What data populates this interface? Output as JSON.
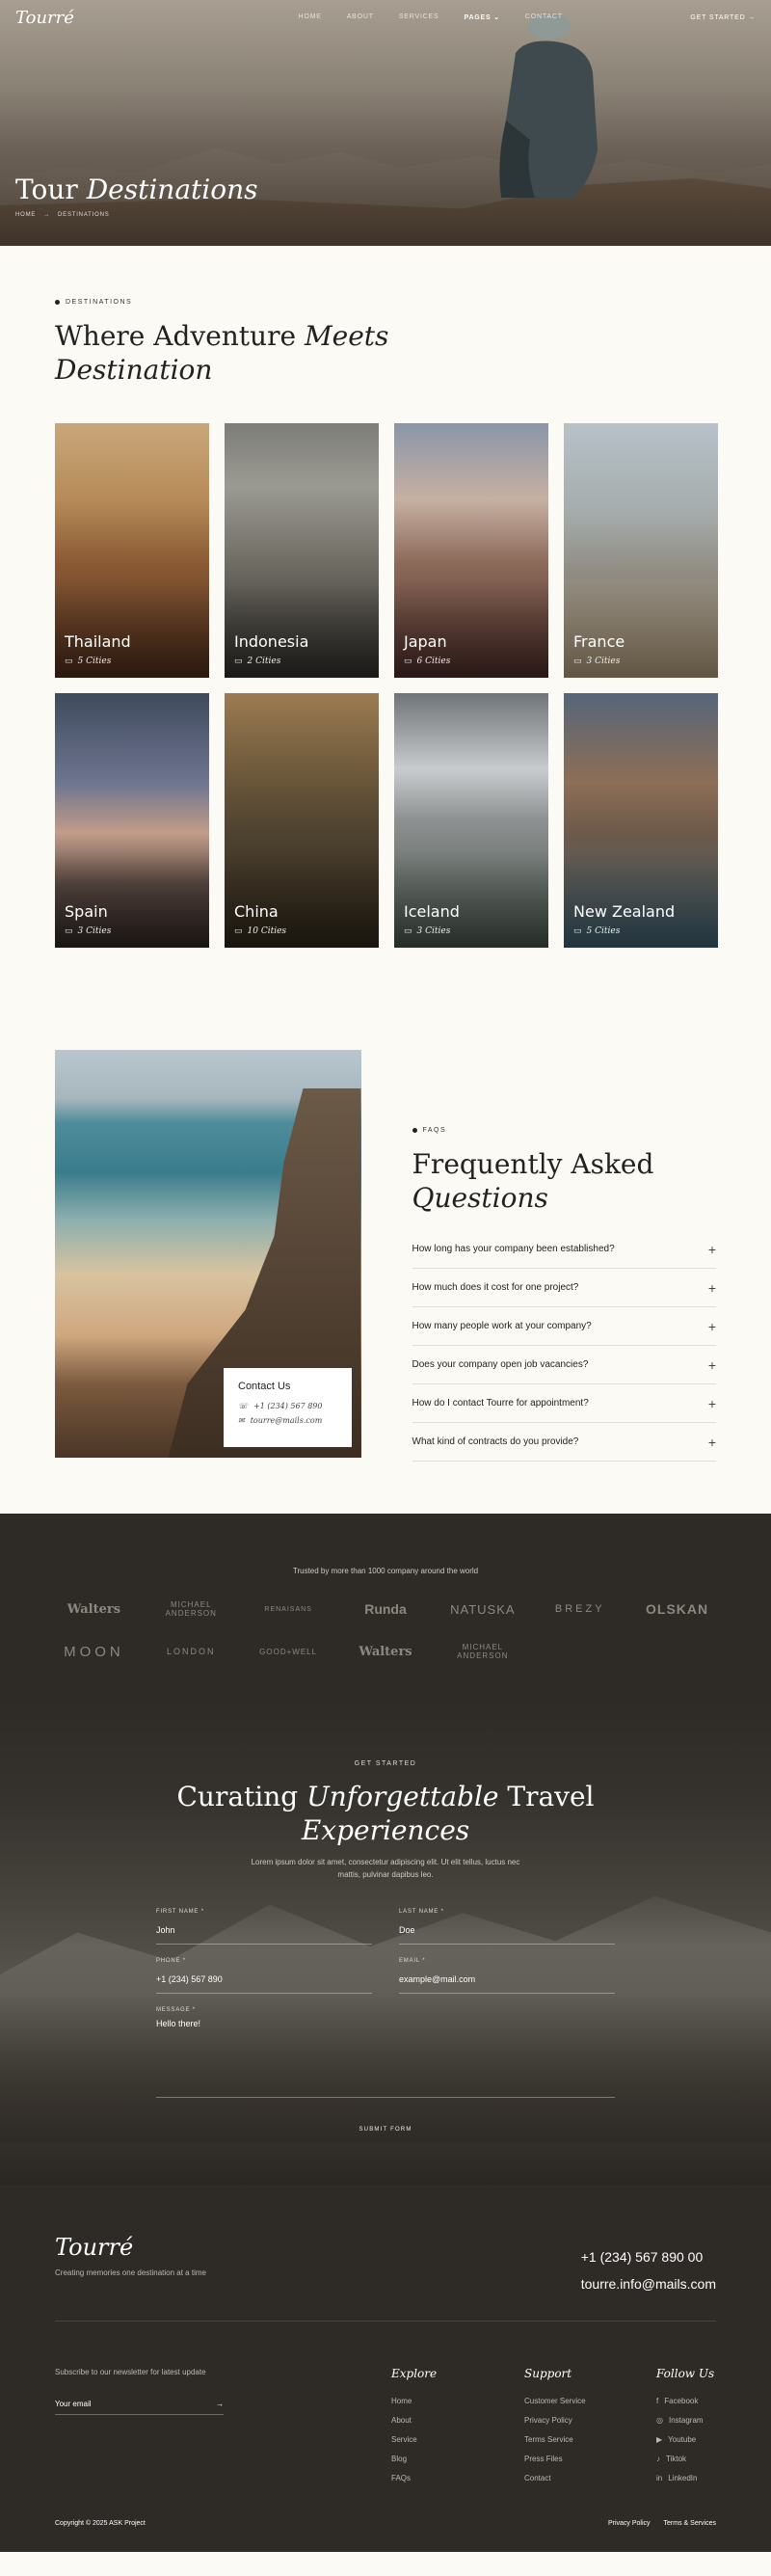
{
  "header": {
    "logo": "Tourré",
    "menu": [
      {
        "label": "HOME"
      },
      {
        "label": "ABOUT"
      },
      {
        "label": "SERVICES"
      },
      {
        "label": "PAGES ⌄"
      },
      {
        "label": "CONTACT"
      }
    ],
    "cta": "GET STARTED →"
  },
  "hero": {
    "title_plain": "Tour",
    "title_italic": "Destinations",
    "crumb_home": "HOME",
    "crumb_sep": "→",
    "crumb_current": "DESTINATIONS"
  },
  "destinations": {
    "eyebrow": "DESTINATIONS",
    "title_plain": "Where Adventure",
    "title_italic_1": "Meets",
    "title_italic_2": "Destination",
    "cards": [
      {
        "name": "Thailand",
        "cities": "5 Cities",
        "bg": "linear-gradient(180deg,#c9a77a 0%,#b68b58 30%,#8a5a34 55%,#4d2c1a 100%)"
      },
      {
        "name": "Indonesia",
        "cities": "2 Cities",
        "bg": "linear-gradient(180deg,#7d7d79 0%,#9b9a92 25%,#6f6c64 55%,#2f2d29 100%)"
      },
      {
        "name": "Japan",
        "cities": "6 Cities",
        "bg": "linear-gradient(180deg,#8a96a8 0%,#c6b0a2 30%,#8c6a5a 55%,#4b2c28 100%)"
      },
      {
        "name": "France",
        "cities": "3 Cities",
        "bg": "linear-gradient(180deg,#b7c1c8 0%,#a5acac 35%,#8f8a80 60%,#b09b7c 100%)"
      },
      {
        "name": "Spain",
        "cities": "3 Cities",
        "bg": "linear-gradient(180deg,#3f4a5c 0%,#6d7590 35%,#c29c88 55%,#5b4a45 75%,#2e2622 100%)"
      },
      {
        "name": "China",
        "cities": "10 Cities",
        "bg": "linear-gradient(180deg,#9c7c52 0%,#6f5a3c 30%,#4e4230 55%,#2d2518 100%)"
      },
      {
        "name": "Iceland",
        "cities": "3 Cities",
        "bg": "linear-gradient(180deg,#6f7478 0%,#c9ccce 30%,#8d9090 50%,#45524a 100%)"
      },
      {
        "name": "New Zealand",
        "cities": "5 Cities",
        "bg": "linear-gradient(180deg,#566679 0%,#8d6e57 35%,#6d5a4a 55%,#3e5e70 100%)"
      }
    ]
  },
  "faq": {
    "eyebrow": "FAQS",
    "title_plain": "Frequently Asked",
    "title_italic": "Questions",
    "questions": [
      {
        "q": "How long has your company been established?"
      },
      {
        "q": "How much does it cost for one project?"
      },
      {
        "q": "How many people work at your company?"
      },
      {
        "q": "Does your company open job vacancies?"
      },
      {
        "q": "How do I contact Tourre for appointment?"
      },
      {
        "q": "What kind of contracts do you provide?"
      }
    ],
    "contact": {
      "title": "Contact Us",
      "phone": "+1 (234) 567 890",
      "email": "tourre@mails.com"
    }
  },
  "trust": {
    "text": "Trusted by more than 1000 company around the world",
    "logos": [
      {
        "name": "Walters"
      },
      {
        "name": "MICHAEL ANDERSON"
      },
      {
        "name": "RENAISANS"
      },
      {
        "name": "Runda"
      },
      {
        "name": "NATUSKA"
      },
      {
        "name": "BREZY"
      },
      {
        "name": "OLSKAN"
      },
      {
        "name": "MOON"
      },
      {
        "name": "LONDON"
      },
      {
        "name": "GOOD+WELL"
      },
      {
        "name": "Walters"
      },
      {
        "name": "MICHAEL ANDERSON"
      }
    ]
  },
  "cta": {
    "eyebrow": "GET STARTED",
    "title_1_plain": "Curating",
    "title_1_italic": "Unforgettable",
    "title_1_plain2": "Travel",
    "title_2_italic": "Experiences",
    "desc": "Lorem ipsum dolor sit amet, consectetur adipiscing elit. Ut elit tellus, luctus nec mattis, pulvinar dapibus leo.",
    "first_name_label": "FIRST NAME *",
    "first_name_value": "John",
    "last_name_label": "LAST NAME *",
    "last_name_value": "Doe",
    "phone_label": "PHONE *",
    "phone_value": "+1 (234) 567 890",
    "email_label": "EMAIL *",
    "email_value": "example@mail.com",
    "message_label": "MESSAGE *",
    "message_value": "Hello there!",
    "submit": "SUBMIT FORM"
  },
  "footer": {
    "logo": "Tourré",
    "tagline": "Creating memories one destination at a time",
    "phone": "+1 (234) 567 890 00",
    "email": "tourre.info@mails.com",
    "newsletter_text": "Subscribe to our newsletter for latest update",
    "email_label": "Your email",
    "explore_title": "Explore",
    "explore": [
      {
        "label": "Home"
      },
      {
        "label": "About"
      },
      {
        "label": "Service"
      },
      {
        "label": "Blog"
      },
      {
        "label": "FAQs"
      }
    ],
    "support_title": "Support",
    "support": [
      {
        "label": "Customer Service"
      },
      {
        "label": "Privacy Policy"
      },
      {
        "label": "Terms Service"
      },
      {
        "label": "Press Files"
      },
      {
        "label": "Contact"
      }
    ],
    "follow_title": "Follow Us",
    "follow": [
      {
        "label": "Facebook",
        "icon": "f"
      },
      {
        "label": "Instagram",
        "icon": "◎"
      },
      {
        "label": "Youtube",
        "icon": "▶"
      },
      {
        "label": "Tiktok",
        "icon": "♪"
      },
      {
        "label": "LinkedIn",
        "icon": "in"
      }
    ],
    "copyright": "Copyright © 2025 ASK Project",
    "privacy": "Privacy Policy",
    "terms": "Terms & Services"
  }
}
